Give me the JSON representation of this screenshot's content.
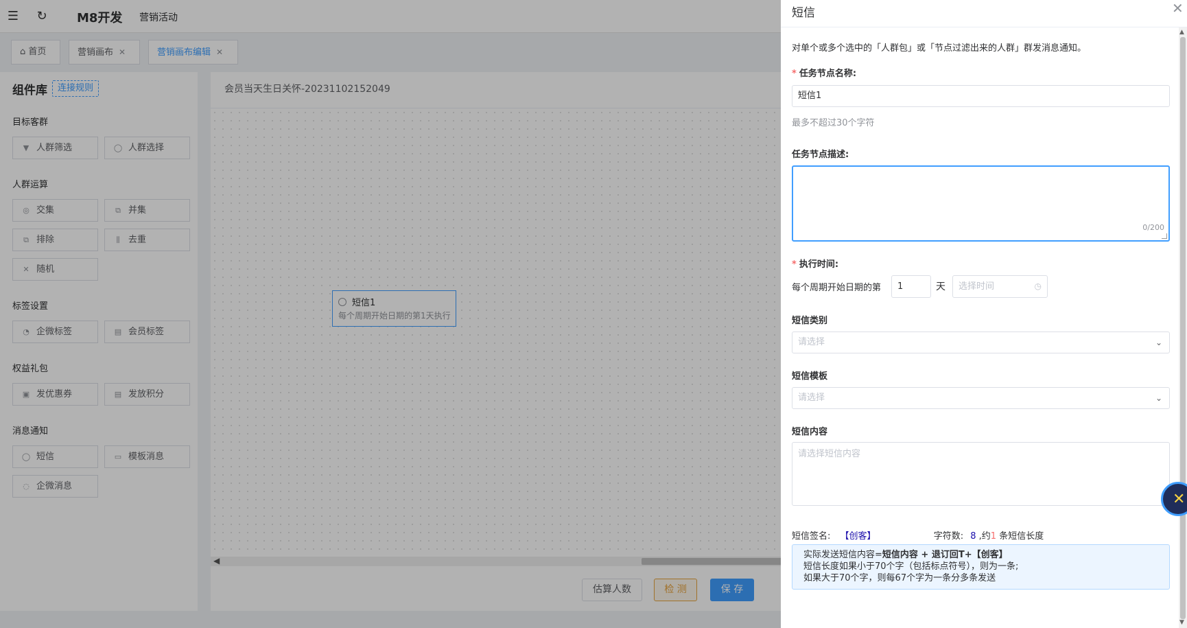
{
  "topbar": {
    "brand": "M8开发",
    "nav_link": "营销活动"
  },
  "tabs": [
    {
      "label": "首页"
    },
    {
      "label": "营销画布"
    },
    {
      "label": "营销画布编辑"
    }
  ],
  "sidebar": {
    "title": "组件库",
    "rule_button": "连接规则",
    "groups": [
      {
        "title": "目标客群",
        "items": [
          "人群筛选",
          "人群选择"
        ]
      },
      {
        "title": "人群运算",
        "items": [
          "交集",
          "并集",
          "排除",
          "去重",
          "随机"
        ]
      },
      {
        "title": "标签设置",
        "items": [
          "企微标签",
          "会员标签"
        ]
      },
      {
        "title": "权益礼包",
        "items": [
          "发优惠券",
          "发放积分"
        ]
      },
      {
        "title": "消息通知",
        "items": [
          "短信",
          "模板消息",
          "企微消息"
        ]
      }
    ]
  },
  "canvas": {
    "title": "会员当天生日关怀-20231102152049",
    "node": {
      "name": "短信1",
      "sub": "每个周期开始日期的第1天执行"
    },
    "buttons": {
      "estimate": "估算人数",
      "check": "检 测",
      "save": "保 存"
    }
  },
  "drawer": {
    "title": "短信",
    "description": "对单个或多个选中的「人群包」或「节点过滤出来的人群」群发消息通知。",
    "task_name": {
      "required_mark": "*",
      "label": "任务节点名称:",
      "value": "短信1",
      "hint": "最多不超过30个字符"
    },
    "task_desc": {
      "label": "任务节点描述:",
      "value": "",
      "counter": "0/200"
    },
    "exec_time": {
      "required_mark": "*",
      "label": "执行时间:",
      "prefix": "每个周期开始日期的第",
      "day_value": "1",
      "unit": "天",
      "time_placeholder": "选择时间"
    },
    "sms_type": {
      "label": "短信类别",
      "placeholder": "请选择"
    },
    "sms_template": {
      "label": "短信模板",
      "placeholder": "请选择"
    },
    "sms_content": {
      "label": "短信内容",
      "placeholder": "请选择短信内容"
    },
    "signature": {
      "label": "短信签名:",
      "value": "【创客】",
      "count_label": "字符数:",
      "count": "8",
      "about": ",约",
      "pieces": "1",
      "suffix": "条短信长度"
    },
    "notice": {
      "line1_prefix": "实际发送短信内容=",
      "line1_bold": "短信内容 + 退订回T+【创客】",
      "line2": "短信长度如果小于70个字（包括标点符号），则为一条;",
      "line3": "如果大于70个字，则每67个字为一条分多条发送"
    }
  },
  "colors": {
    "primary": "#409eff",
    "required": "#f56c6c",
    "warning": "#e6a23c"
  }
}
